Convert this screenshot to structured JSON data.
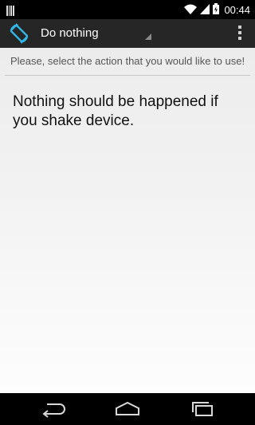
{
  "status_bar": {
    "time": "00:44",
    "icons": [
      "notification-bars-icon",
      "wifi-icon",
      "cell-signal-icon",
      "battery-icon"
    ]
  },
  "action_bar": {
    "app_icon": "screen-rotation-icon",
    "spinner_value": "Do nothing",
    "overflow_icon": "overflow-menu-icon"
  },
  "content": {
    "hint": "Please, select the action that you would like to use!",
    "description": "Nothing should be happened if you shake device."
  },
  "nav_bar": {
    "buttons": [
      "back-icon",
      "home-icon",
      "recent-apps-icon"
    ]
  },
  "colors": {
    "accent": "#33b5e5",
    "action_bar": "#262626",
    "status_bar": "#000000"
  }
}
